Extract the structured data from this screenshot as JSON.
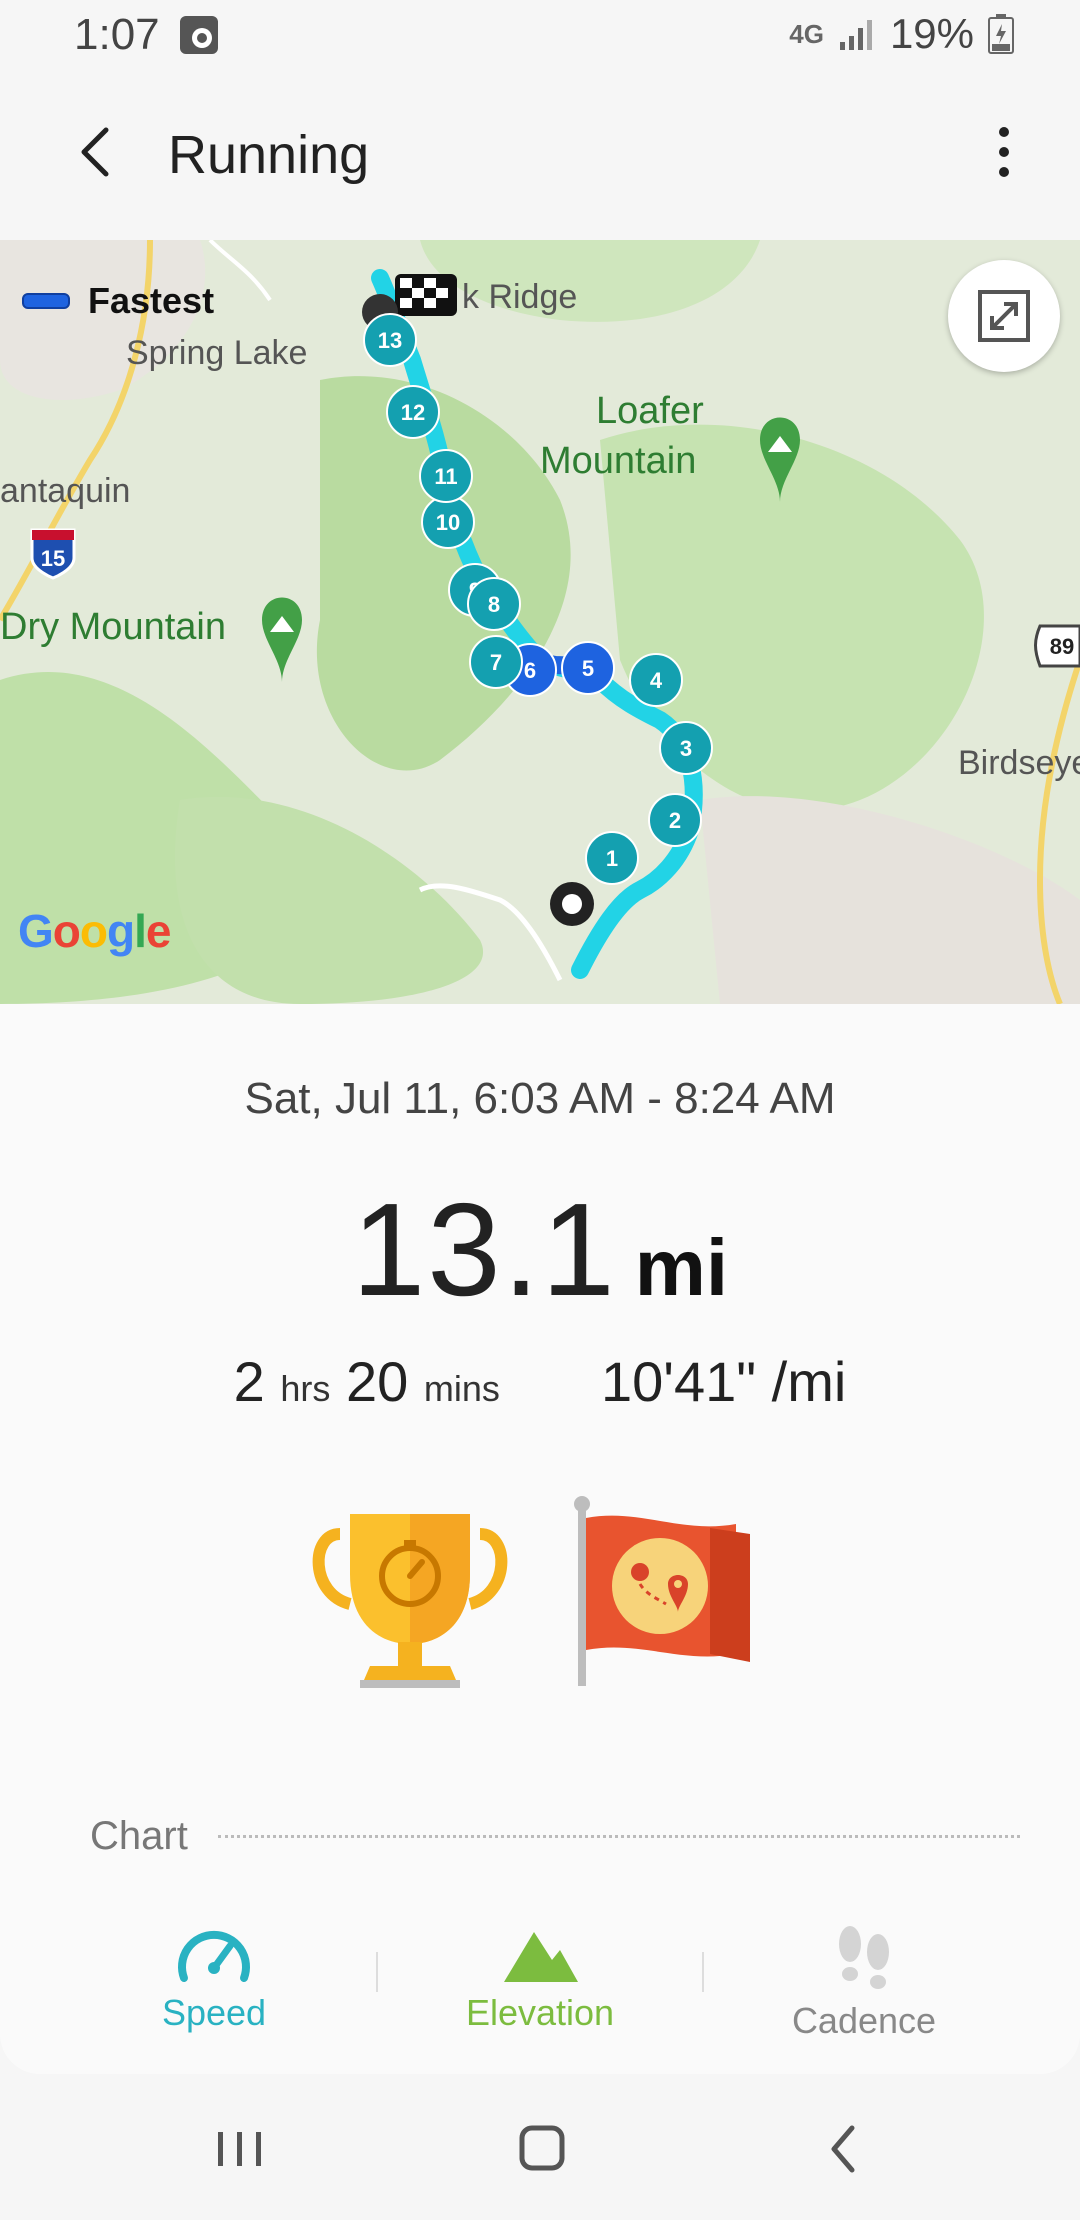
{
  "status_bar": {
    "time": "1:07",
    "network": "4G",
    "battery_text": "19%"
  },
  "app_bar": {
    "title": "Running"
  },
  "map": {
    "legend_label": "Fastest",
    "labels": {
      "ridge": "k Ridge",
      "spring_lake": "Spring Lake",
      "loafer": "Loafer",
      "loafer2": "Mountain",
      "santaquin": "antaquin",
      "highway": "15",
      "dry_mountain": "Dry Mountain",
      "birdseye": "Birdseye",
      "us_route": "89"
    },
    "markers": [
      "1",
      "2",
      "3",
      "4",
      "5",
      "6",
      "7",
      "8",
      "9",
      "10",
      "11",
      "12",
      "13"
    ],
    "brand": "Google",
    "colors": {
      "route": "#22d3e6",
      "fastest": "#1e63e0",
      "marker": "#14a0b0"
    }
  },
  "summary": {
    "date_range": "Sat, Jul 11, 6:03 AM - 8:24 AM",
    "distance_value": "13.1",
    "distance_unit": "mi",
    "duration_hours": "2",
    "duration_hours_unit": "hrs",
    "duration_mins": "20",
    "duration_mins_unit": "mins",
    "pace": "10'41\" /mi"
  },
  "chart_section": {
    "label": "Chart",
    "tabs": [
      {
        "label": "Speed",
        "color": "#29b2c2"
      },
      {
        "label": "Elevation",
        "color": "#7cbc3f"
      },
      {
        "label": "Cadence",
        "color": "#888888"
      }
    ]
  }
}
